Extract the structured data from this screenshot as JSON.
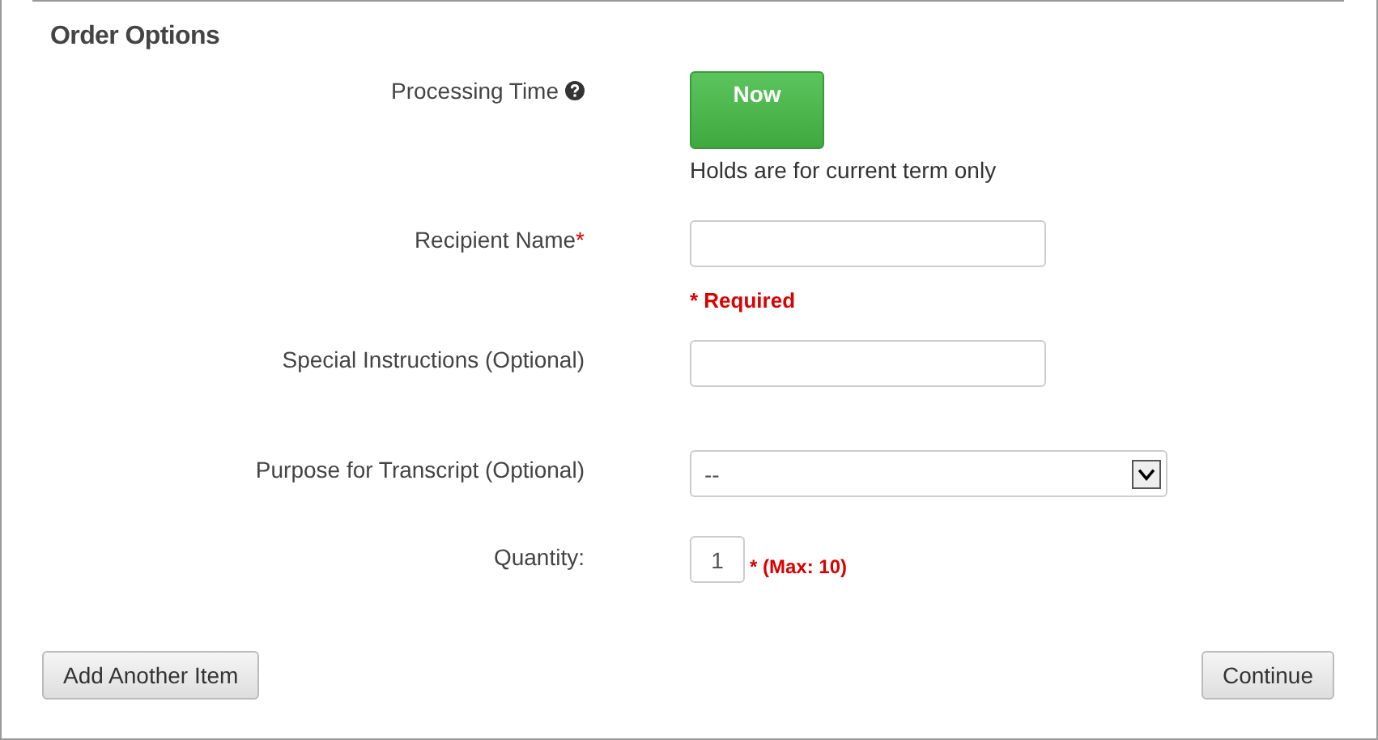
{
  "section_title": "Order Options",
  "processing_time": {
    "label": "Processing Time",
    "button": "Now",
    "note": "Holds are for current term only"
  },
  "recipient_name": {
    "label": "Recipient Name",
    "required_mark": "*",
    "error": "* Required"
  },
  "special_instructions": {
    "label": "Special Instructions (Optional)"
  },
  "purpose": {
    "label": "Purpose for Transcript (Optional)",
    "value": "--"
  },
  "quantity": {
    "label": "Quantity:",
    "value": "1",
    "hint": "* (Max: 10)"
  },
  "buttons": {
    "add": "Add Another Item",
    "continue": "Continue"
  }
}
